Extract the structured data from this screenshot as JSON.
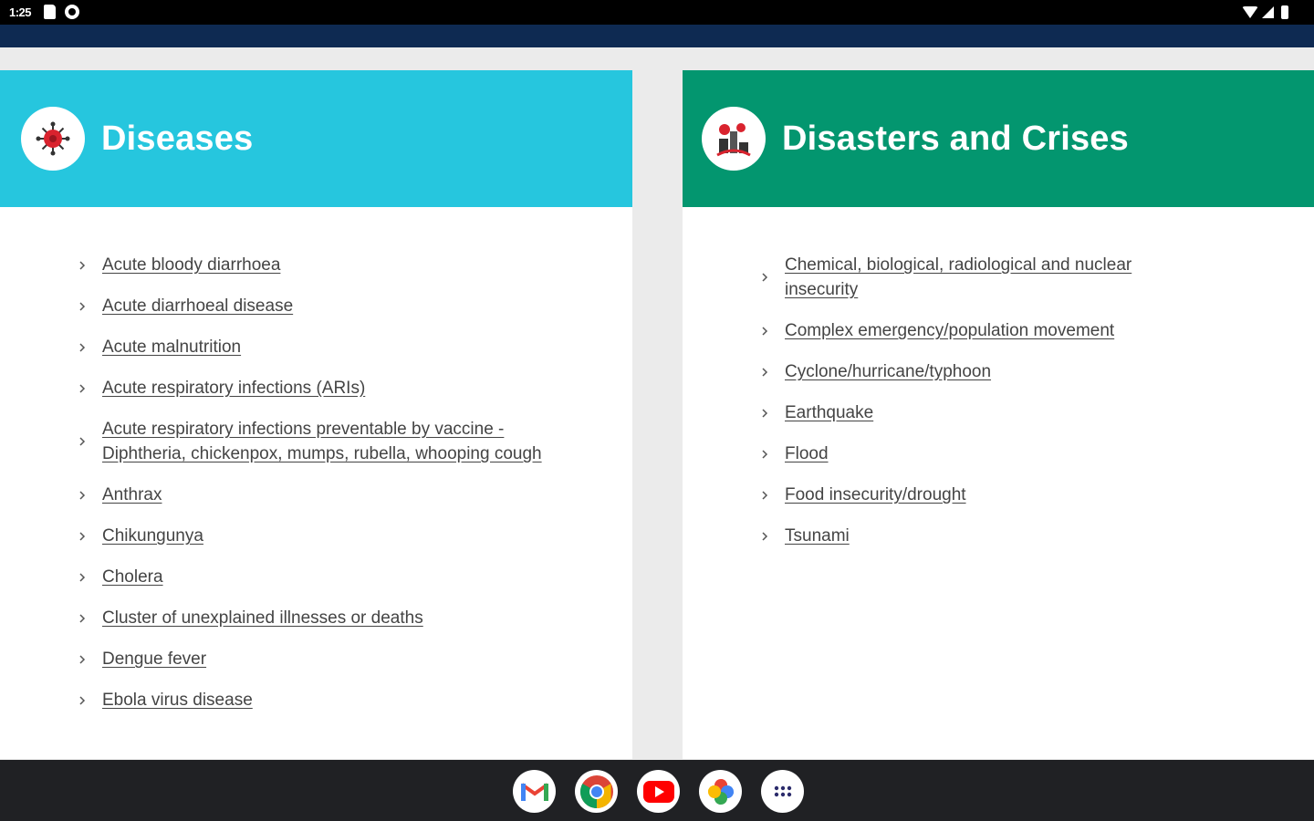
{
  "status_bar": {
    "time": "1:25",
    "icons": [
      "sd-card-icon",
      "data-saver-icon",
      "wifi-icon",
      "signal-icon",
      "battery-icon"
    ]
  },
  "diseases": {
    "title": "Diseases",
    "icon": "virus-icon",
    "color": "#26c6de",
    "items": [
      "Acute bloody diarrhoea",
      "Acute diarrhoeal disease",
      "Acute malnutrition",
      "Acute respiratory infections (ARIs)",
      "Acute respiratory infections preventable by vaccine - Diphtheria, chickenpox, mumps, rubella, whooping cough",
      "Anthrax",
      "Chikungunya",
      "Cholera",
      "Cluster of unexplained illnesses or deaths",
      "Dengue fever",
      "Ebola virus disease"
    ]
  },
  "disasters": {
    "title": "Disasters and Crises",
    "icon": "disaster-icon",
    "color": "#03966f",
    "items": [
      "Chemical, biological, radiological and nuclear insecurity",
      "Complex emergency/population movement",
      "Cyclone/hurricane/typhoon",
      "Earthquake",
      "Flood",
      "Food insecurity/drought",
      "Tsunami"
    ]
  },
  "dock": {
    "apps": [
      "gmail-icon",
      "chrome-icon",
      "youtube-icon",
      "photos-icon",
      "app-drawer-icon"
    ]
  }
}
